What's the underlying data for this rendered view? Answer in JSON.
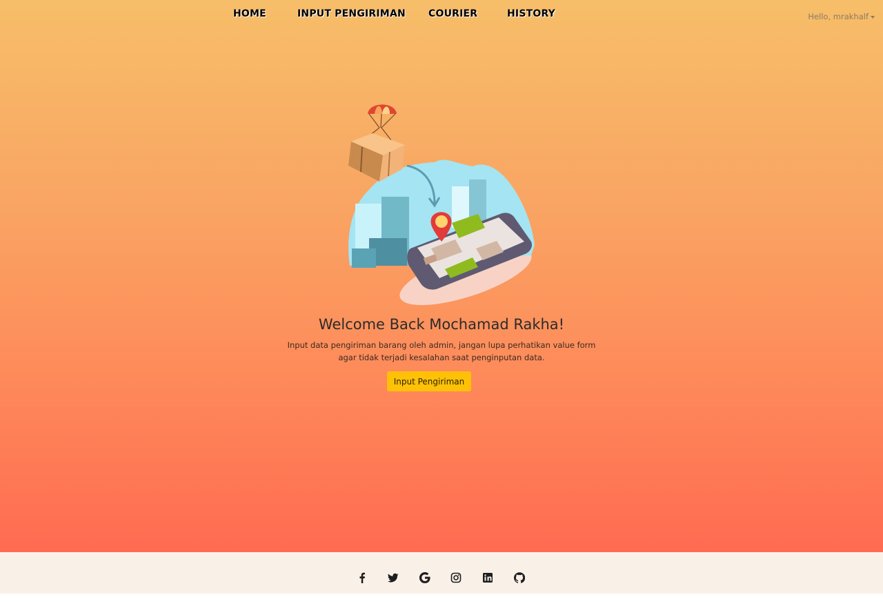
{
  "nav": {
    "items": [
      {
        "label": "HOME"
      },
      {
        "label": "INPUT PENGIRIMAN"
      },
      {
        "label": "COURIER"
      },
      {
        "label": "HISTORY"
      }
    ],
    "user_greeting": "Hello, mrakhalf"
  },
  "hero": {
    "title": "Welcome Back Mochamad Rakha!",
    "description": "Input data pengiriman barang oleh admin, jangan lupa perhatikan value form agar tidak terjadi kesalahan saat penginputan data.",
    "cta_label": "Input Pengiriman"
  },
  "footer": {
    "social_icons": [
      "facebook-icon",
      "twitter-icon",
      "google-icon",
      "instagram-icon",
      "linkedin-icon",
      "github-icon"
    ]
  },
  "colors": {
    "gradient_top": "#f7be69",
    "gradient_bottom": "#ff6b51",
    "cta": "#ffc107",
    "footer_bg": "#f9f1e8"
  }
}
